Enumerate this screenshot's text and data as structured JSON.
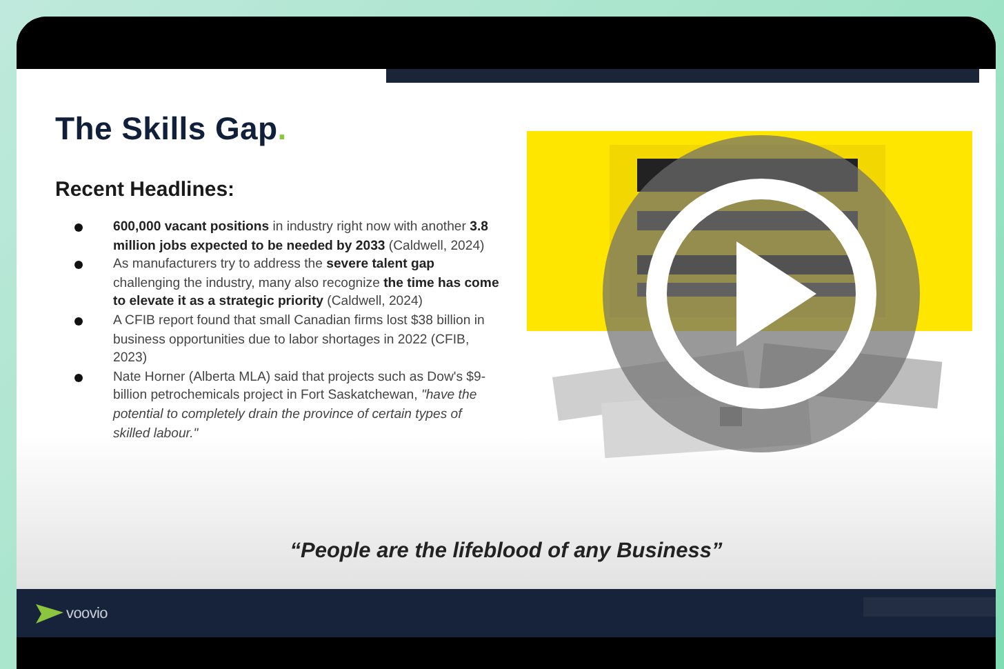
{
  "video": {
    "slide": {
      "title": "The Skills Gap",
      "title_mark": ".",
      "subtitle": "Recent Headlines:",
      "bullets": [
        "**600,000 vacant positions** in industry right now with another **3.8 million jobs expected to be needed by 2033** (Caldwell, 2024)",
        "As manufacturers try to address the **severe talent gap** challenging the industry, many also recognize **the time has come to elevate it as a strategic priority** (Caldwell, 2024)",
        "A CFIB report found that small Canadian firms lost $38 billion in business opportunities due to labor shortages in 2022 (CFIB, 2023)",
        "Nate Horner (Alberta MLA) said that projects such as Dow's $9-billion petrochemicals project in Fort Saskatchewan, *\"have the potential to completely drain the province of certain types of skilled labour.\"*"
      ],
      "quote": "“People are the lifeblood of any Business”",
      "footer_logo": "voovio"
    },
    "playing": false
  }
}
